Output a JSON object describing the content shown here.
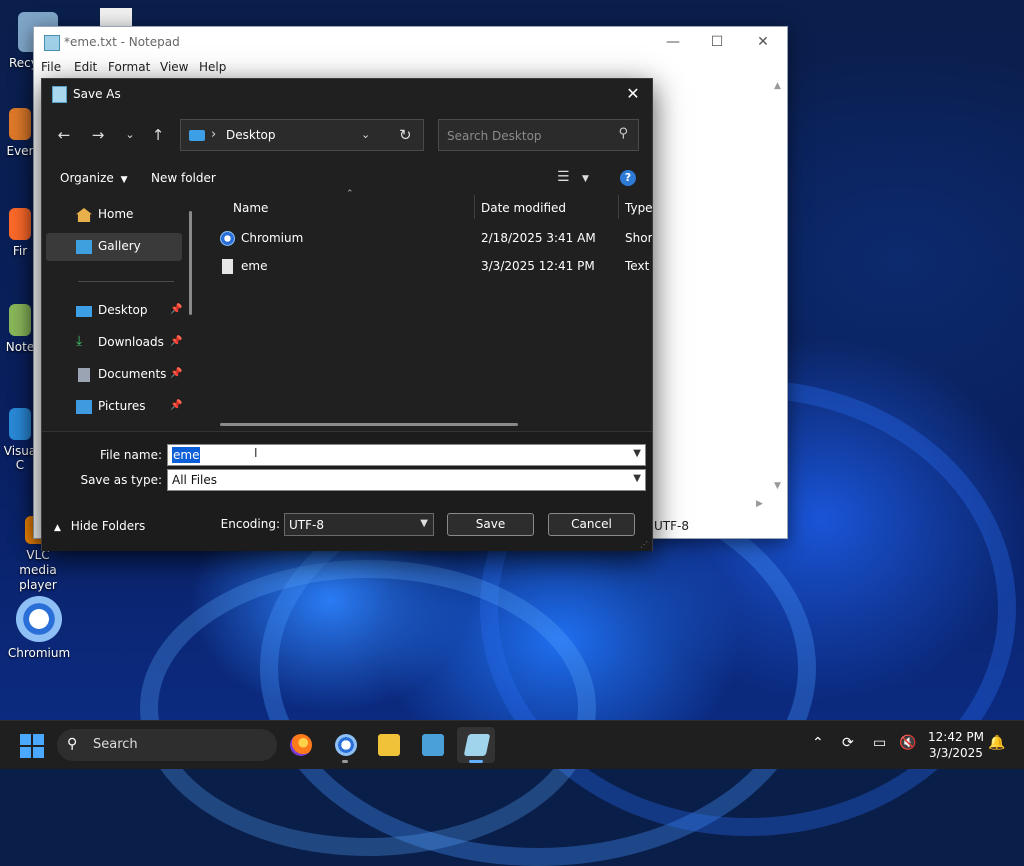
{
  "desktop": {
    "icons": [
      {
        "label": "Recy"
      },
      {
        "label": "Ever"
      },
      {
        "label": "Fir"
      },
      {
        "label": "Note"
      },
      {
        "label": "Visua\nC"
      },
      {
        "label": "VLC media player"
      },
      {
        "label": "Chromium"
      }
    ]
  },
  "notepad": {
    "title": "*eme.txt - Notepad",
    "menu": [
      "File",
      "Edit",
      "Format",
      "View",
      "Help"
    ],
    "status_encoding": "UTF-8"
  },
  "dialog": {
    "title": "Save As",
    "address": {
      "location": "Desktop"
    },
    "search": {
      "placeholder": "Search Desktop"
    },
    "toolbar": {
      "organize": "Organize",
      "new_folder": "New folder"
    },
    "nav": {
      "home": "Home",
      "gallery": "Gallery",
      "desktop": "Desktop",
      "downloads": "Downloads",
      "documents": "Documents",
      "pictures": "Pictures"
    },
    "columns": {
      "name": "Name",
      "date": "Date modified",
      "type": "Type"
    },
    "files": [
      {
        "name": "Chromium",
        "date": "2/18/2025 3:41 AM",
        "type": "Shortcut"
      },
      {
        "name": "eme",
        "date": "3/3/2025 12:41 PM",
        "type": "Text Document"
      }
    ],
    "file_name_label": "File name:",
    "file_name_value": "eme",
    "save_as_type_label": "Save as type:",
    "save_as_type_value": "All Files",
    "encoding_label": "Encoding:",
    "encoding_value": "UTF-8",
    "save_label": "Save",
    "cancel_label": "Cancel",
    "hide_folders_label": "Hide Folders"
  },
  "taskbar": {
    "search_label": "Search",
    "time": "12:42 PM",
    "date": "3/3/2025"
  },
  "colors": {
    "accent": "#0a5fd8",
    "dialog_bg": "#202020"
  }
}
